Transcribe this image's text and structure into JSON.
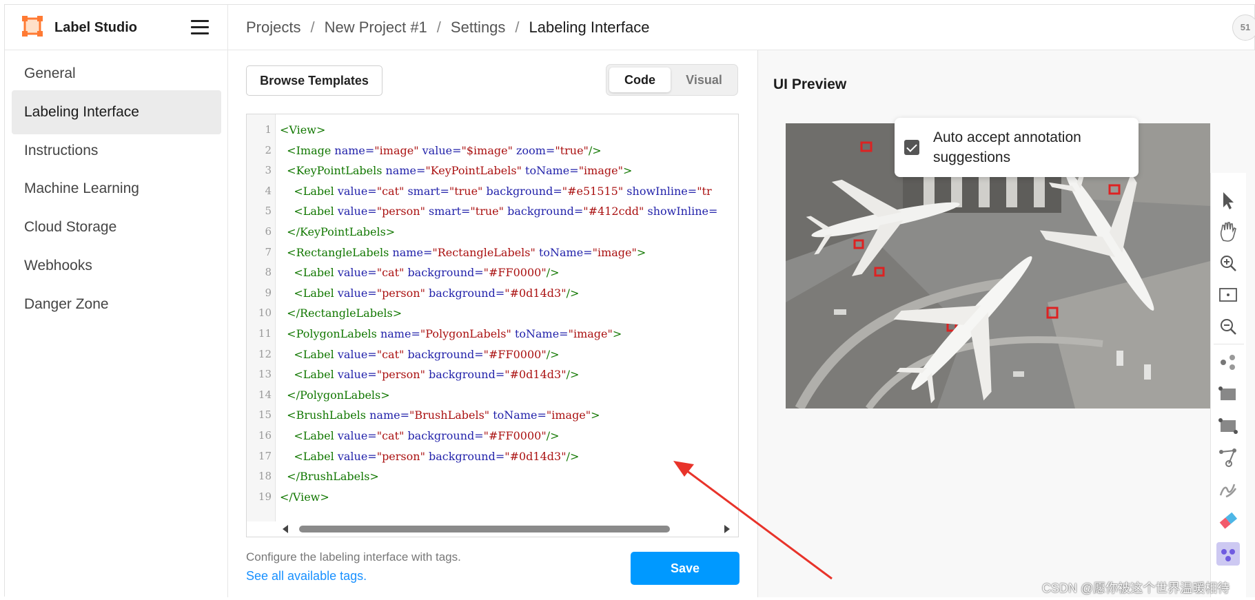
{
  "app": {
    "name": "Label Studio",
    "avatar_text": "51"
  },
  "breadcrumb": [
    {
      "label": "Projects"
    },
    {
      "label": "New Project #1"
    },
    {
      "label": "Settings"
    },
    {
      "label": "Labeling Interface"
    }
  ],
  "breadcrumb_sep": "/",
  "sidebar": {
    "items": [
      {
        "label": "General",
        "active": false
      },
      {
        "label": "Labeling Interface",
        "active": true
      },
      {
        "label": "Instructions",
        "active": false
      },
      {
        "label": "Machine Learning",
        "active": false
      },
      {
        "label": "Cloud Storage",
        "active": false
      },
      {
        "label": "Webhooks",
        "active": false
      },
      {
        "label": "Danger Zone",
        "active": false
      }
    ]
  },
  "editor": {
    "browse_label": "Browse Templates",
    "mode_code": "Code",
    "mode_visual": "Visual",
    "active_mode": "Code",
    "lines": [
      [
        [
          "tag",
          "<View>"
        ]
      ],
      [
        [
          "tag",
          "  <Image "
        ],
        [
          "attr",
          "name="
        ],
        [
          "str",
          "\"image\" "
        ],
        [
          "attr",
          "value="
        ],
        [
          "str",
          "\"$image\" "
        ],
        [
          "attr",
          "zoom="
        ],
        [
          "str",
          "\"true\""
        ],
        [
          "tag",
          "/>"
        ]
      ],
      [
        [
          "tag",
          "  <KeyPointLabels "
        ],
        [
          "attr",
          "name="
        ],
        [
          "str",
          "\"KeyPointLabels\" "
        ],
        [
          "attr",
          "toName="
        ],
        [
          "str",
          "\"image\""
        ],
        [
          "tag",
          ">"
        ]
      ],
      [
        [
          "tag",
          "    <Label "
        ],
        [
          "attr",
          "value="
        ],
        [
          "str",
          "\"cat\" "
        ],
        [
          "attr",
          "smart="
        ],
        [
          "str",
          "\"true\" "
        ],
        [
          "attr",
          "background="
        ],
        [
          "str",
          "\"#e51515\" "
        ],
        [
          "attr",
          "showInline="
        ],
        [
          "str",
          "\"tr"
        ]
      ],
      [
        [
          "tag",
          "    <Label "
        ],
        [
          "attr",
          "value="
        ],
        [
          "str",
          "\"person\" "
        ],
        [
          "attr",
          "smart="
        ],
        [
          "str",
          "\"true\" "
        ],
        [
          "attr",
          "background="
        ],
        [
          "str",
          "\"#412cdd\" "
        ],
        [
          "attr",
          "showInline="
        ]
      ],
      [
        [
          "tag",
          "  </KeyPointLabels>"
        ]
      ],
      [
        [
          "tag",
          "  <RectangleLabels "
        ],
        [
          "attr",
          "name="
        ],
        [
          "str",
          "\"RectangleLabels\" "
        ],
        [
          "attr",
          "toName="
        ],
        [
          "str",
          "\"image\""
        ],
        [
          "tag",
          ">"
        ]
      ],
      [
        [
          "tag",
          "    <Label "
        ],
        [
          "attr",
          "value="
        ],
        [
          "str",
          "\"cat\" "
        ],
        [
          "attr",
          "background="
        ],
        [
          "str",
          "\"#FF0000\""
        ],
        [
          "tag",
          "/>"
        ]
      ],
      [
        [
          "tag",
          "    <Label "
        ],
        [
          "attr",
          "value="
        ],
        [
          "str",
          "\"person\" "
        ],
        [
          "attr",
          "background="
        ],
        [
          "str",
          "\"#0d14d3\""
        ],
        [
          "tag",
          "/>"
        ]
      ],
      [
        [
          "tag",
          "  </RectangleLabels>"
        ]
      ],
      [
        [
          "tag",
          "  <PolygonLabels "
        ],
        [
          "attr",
          "name="
        ],
        [
          "str",
          "\"PolygonLabels\" "
        ],
        [
          "attr",
          "toName="
        ],
        [
          "str",
          "\"image\""
        ],
        [
          "tag",
          ">"
        ]
      ],
      [
        [
          "tag",
          "    <Label "
        ],
        [
          "attr",
          "value="
        ],
        [
          "str",
          "\"cat\" "
        ],
        [
          "attr",
          "background="
        ],
        [
          "str",
          "\"#FF0000\""
        ],
        [
          "tag",
          "/>"
        ]
      ],
      [
        [
          "tag",
          "    <Label "
        ],
        [
          "attr",
          "value="
        ],
        [
          "str",
          "\"person\" "
        ],
        [
          "attr",
          "background="
        ],
        [
          "str",
          "\"#0d14d3\""
        ],
        [
          "tag",
          "/>"
        ]
      ],
      [
        [
          "tag",
          "  </PolygonLabels>"
        ]
      ],
      [
        [
          "tag",
          "  <BrushLabels "
        ],
        [
          "attr",
          "name="
        ],
        [
          "str",
          "\"BrushLabels\" "
        ],
        [
          "attr",
          "toName="
        ],
        [
          "str",
          "\"image\""
        ],
        [
          "tag",
          ">"
        ]
      ],
      [
        [
          "tag",
          "    <Label "
        ],
        [
          "attr",
          "value="
        ],
        [
          "str",
          "\"cat\" "
        ],
        [
          "attr",
          "background="
        ],
        [
          "str",
          "\"#FF0000\""
        ],
        [
          "tag",
          "/>"
        ]
      ],
      [
        [
          "tag",
          "    <Label "
        ],
        [
          "attr",
          "value="
        ],
        [
          "str",
          "\"person\" "
        ],
        [
          "attr",
          "background="
        ],
        [
          "str",
          "\"#0d14d3\""
        ],
        [
          "tag",
          "/>"
        ]
      ],
      [
        [
          "tag",
          "  </BrushLabels>"
        ]
      ],
      [
        [
          "tag",
          "</View>"
        ]
      ]
    ],
    "help_text": "Configure the labeling interface with tags.",
    "help_link": "See all available tags.",
    "save_label": "Save"
  },
  "preview": {
    "title": "UI Preview",
    "auto_accept_label": "Auto accept annotation suggestions",
    "auto_accept_checked": true,
    "image_subject": "aerial-airport-planes"
  },
  "toolbar_icons": [
    "pointer-icon",
    "hand-pan-icon",
    "zoom-in-icon",
    "fit-to-screen-icon",
    "zoom-out-icon",
    "keypoint-icon",
    "rectangle-icon",
    "rectangle-3point-icon",
    "polygon-icon",
    "brush-icon",
    "eraser-icon",
    "auto-detect-icon"
  ],
  "colors": {
    "primary": "#0099ff",
    "link": "#1890ff",
    "tag": "#117700",
    "attr": "#2222aa",
    "string": "#aa1111",
    "annotation_arrow": "#e8332a"
  },
  "watermark": "CSDN @愿你被这个世界温暖相待"
}
